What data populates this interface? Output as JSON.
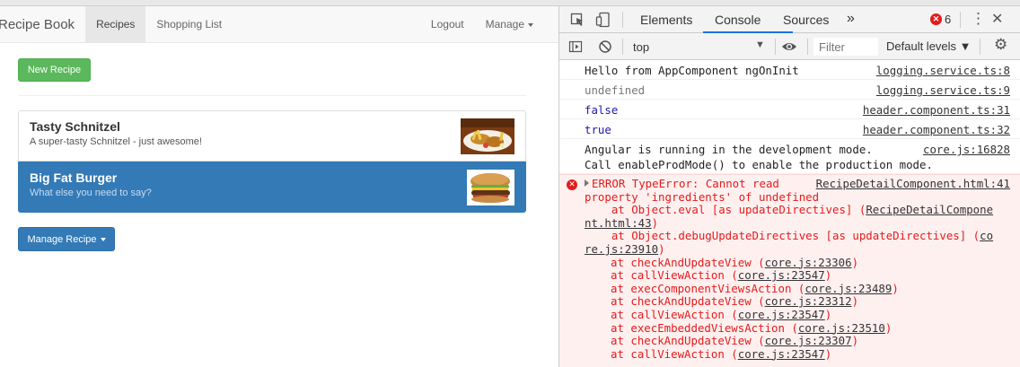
{
  "app": {
    "brand": "Recipe Book",
    "nav": {
      "recipes": "Recipes",
      "shopping_list": "Shopping List",
      "logout": "Logout",
      "manage": "Manage"
    },
    "new_recipe_label": "New Recipe",
    "recipes": [
      {
        "name": "Tasty Schnitzel",
        "description": "A super-tasty Schnitzel - just awesome!",
        "image": "schnitzel-image"
      },
      {
        "name": "Big Fat Burger",
        "description": "What else you need to say?",
        "image": "burger-image"
      }
    ],
    "manage_recipe_label": "Manage Recipe"
  },
  "devtools": {
    "tabs": {
      "elements": "Elements",
      "console": "Console",
      "sources": "Sources",
      "more": "»"
    },
    "error_count": "6",
    "context": "top",
    "filter_placeholder": "Filter",
    "levels": "Default levels ▼",
    "messages": [
      {
        "text": "Hello from AppComponent ngOnInit",
        "source": "logging.service.ts:8"
      },
      {
        "text": "undefined",
        "source": "logging.service.ts:9"
      },
      {
        "text": "false",
        "source": "header.component.ts:31"
      },
      {
        "text": "true",
        "source": "header.component.ts:32"
      },
      {
        "text": "Angular is running in the development mode.",
        "text2": "Call enableProdMode() to enable the production mode.",
        "source": "core.js:16828"
      }
    ],
    "error": {
      "head": "ERROR TypeError: Cannot read",
      "source": "RecipeDetailComponent.html:41",
      "line2": "property 'ingredients' of undefined",
      "line3_pre": "    at Object.eval [as updateDirectives] (",
      "line3_link": "RecipeDetailCompone",
      "line4_link": "nt.html:43",
      "line4_post": ")",
      "line5_pre": "    at Object.debugUpdateDirectives [as updateDirectives] (",
      "line5_link": "co",
      "line6_link": "re.js:23910",
      "line6_post": ")",
      "stack": [
        {
          "pre": "at checkAndUpdateView (",
          "link": "core.js:23306",
          "post": ")"
        },
        {
          "pre": "at callViewAction (",
          "link": "core.js:23547",
          "post": ")"
        },
        {
          "pre": "at execComponentViewsAction (",
          "link": "core.js:23489",
          "post": ")"
        },
        {
          "pre": "at checkAndUpdateView (",
          "link": "core.js:23312",
          "post": ")"
        },
        {
          "pre": "at callViewAction (",
          "link": "core.js:23547",
          "post": ")"
        },
        {
          "pre": "at execEmbeddedViewsAction (",
          "link": "core.js:23510",
          "post": ")"
        },
        {
          "pre": "at checkAndUpdateView (",
          "link": "core.js:23307",
          "post": ")"
        },
        {
          "pre": "at callViewAction (",
          "link": "core.js:23547",
          "post": ")"
        }
      ]
    }
  }
}
